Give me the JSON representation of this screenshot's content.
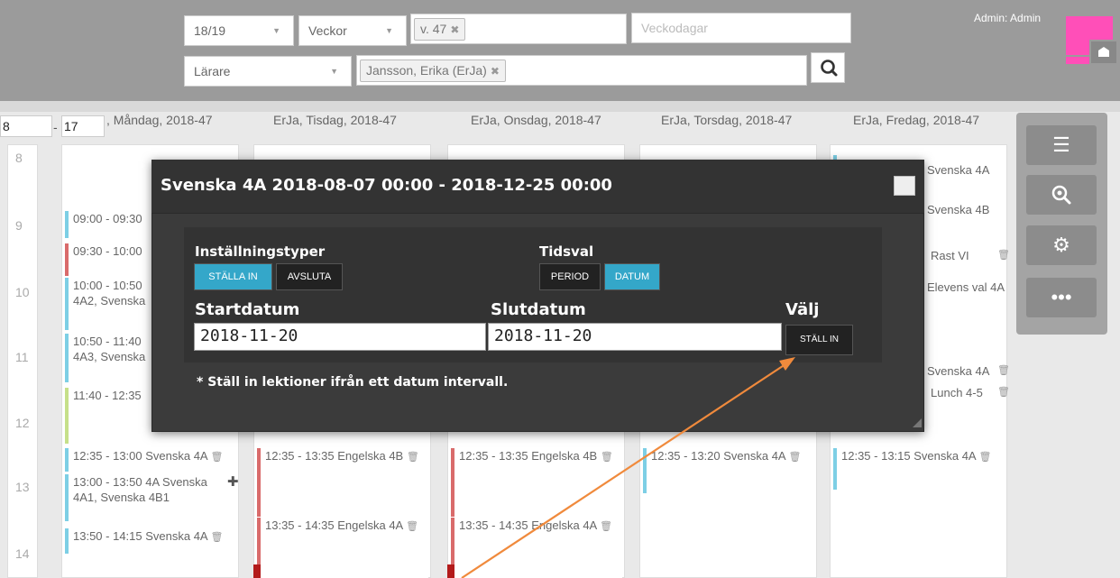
{
  "filters": {
    "year": "18/19",
    "period_type": "Veckor",
    "week_chip": "v. 47",
    "weekdays_placeholder": "Veckodagar",
    "role": "Lärare",
    "teacher_chip": "Jansson, Erika (ErJa)",
    "remove_glyph": "✖",
    "dropdown_glyph": "▼"
  },
  "user": {
    "label": "Admin: Admin"
  },
  "calendar": {
    "hour_from": "8",
    "hour_to": "17",
    "dash": "-",
    "hours": [
      "8",
      "9",
      "10",
      "11",
      "12",
      "13",
      "14"
    ],
    "days": [
      {
        "header": ", Måndag, 2018-47"
      },
      {
        "header": "ErJa, Tisdag, 2018-47"
      },
      {
        "header": "ErJa, Onsdag, 2018-47"
      },
      {
        "header": "ErJa, Torsdag, 2018-47"
      },
      {
        "header": "ErJa, Fredag, 2018-47"
      }
    ],
    "lessons": {
      "mon_0900": "09:00 - 09:30",
      "mon_0930": "09:30 - 10:00",
      "mon_1000": "10:00 - 10:50",
      "mon_1000_b": "4A2, Svenska",
      "mon_1050": "10:50 - 11:40",
      "mon_1050_b": "4A3, Svenska",
      "mon_1140": "11:40 - 12:35",
      "mon_1235": "12:35 - 13:00 Svenska 4A",
      "mon_1300": "13:00 - 13:50 4A Svenska",
      "mon_1300_b": "4A1, Svenska 4B1",
      "mon_1350": "13:50 - 14:15 Svenska 4A",
      "tue_1235": "12:35 - 13:35 Engelska 4B",
      "tue_1335": "13:35 - 14:35 Engelska 4A",
      "wed_1235": "12:35 - 13:35 Engelska 4B",
      "wed_1335": "13:35 - 14:35 Engelska 4A",
      "thu_1235": "12:35 - 13:20 Svenska 4A",
      "fri_1": "Svenska 4A",
      "fri_2": "Svenska 4B",
      "fri_3": "Rast VI",
      "fri_4": "Elevens val 4A",
      "fri_5": "Svenska 4A",
      "fri_6": "Lunch 4-5",
      "fri_1235": "12:35 - 13:15 Svenska 4A"
    }
  },
  "tools": [
    "list-icon",
    "search-zoom-icon",
    "gear-icon",
    "more-icon"
  ],
  "modal": {
    "title": "Svenska 4A 2018-08-07 00:00 - 2018-12-25 00:00",
    "settings_label": "Inställningstyper",
    "btn_set": "STÄLLA IN",
    "btn_end": "AVSLUTA",
    "time_label": "Tidsval",
    "btn_period": "PERIOD",
    "btn_date": "DATUM",
    "start_label": "Startdatum",
    "end_label": "Slutdatum",
    "choose_label": "Välj",
    "start_value": "2018-11-20",
    "end_value": "2018-11-20",
    "btn_apply": "STÄLL IN",
    "hint": "* Ställ in lektioner ifrån ett datum intervall."
  },
  "colors": {
    "accent": "#34a7c9",
    "arrow": "#f08a3c",
    "brand": "#ff4fb8"
  }
}
